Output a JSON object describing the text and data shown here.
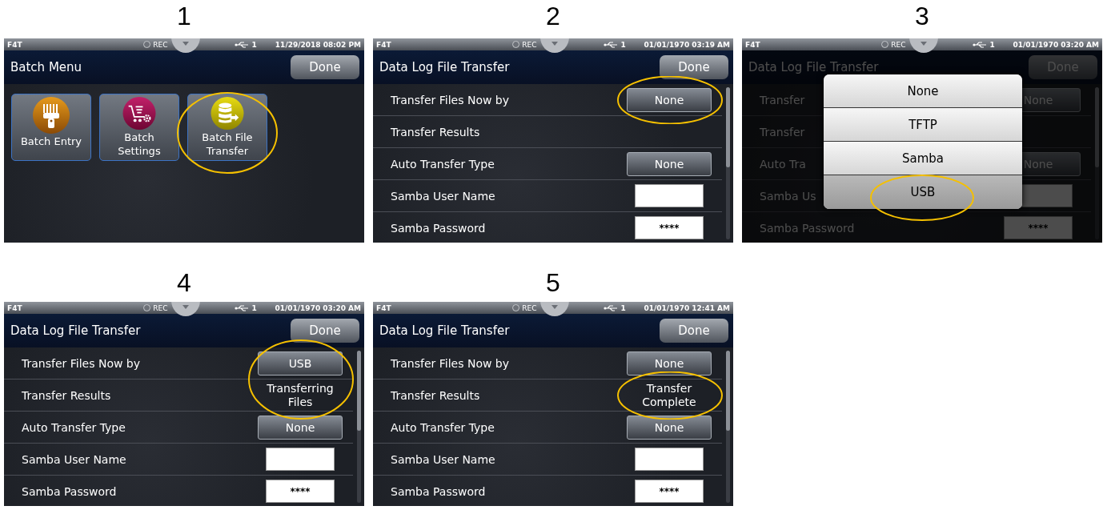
{
  "screens": [
    {
      "step": "1",
      "status_bar": {
        "device": "F4T",
        "rec": "REC",
        "usb": "1",
        "datetime": "11/29/2018 08:02 PM"
      },
      "title": "Batch Menu",
      "done": "Done",
      "dimmed": false,
      "tiles": [
        {
          "label": "Batch Entry",
          "kind": "scanner",
          "circled": false
        },
        {
          "label": "Batch Settings",
          "kind": "cart",
          "circled": false
        },
        {
          "label": "Batch File Transfer",
          "kind": "database",
          "circled": true
        }
      ]
    },
    {
      "step": "2",
      "status_bar": {
        "device": "F4T",
        "rec": "REC",
        "usb": "1",
        "datetime": "01/01/1970 03:19 AM"
      },
      "title": "Data Log File Transfer",
      "done": "Done",
      "dimmed": false,
      "rows": [
        {
          "label": "Transfer Files Now by",
          "kind": "button",
          "value": "None",
          "circled": true
        },
        {
          "label": "Transfer Results",
          "kind": "empty",
          "circled": false
        },
        {
          "label": "Auto Transfer Type",
          "kind": "button",
          "value": "None",
          "circled": false
        },
        {
          "label": "Samba User Name",
          "kind": "field",
          "circled": false
        },
        {
          "label": "Samba Password",
          "kind": "field",
          "value": "****",
          "circled": false
        }
      ]
    },
    {
      "step": "3",
      "status_bar": {
        "device": "F4T",
        "rec": "REC",
        "usb": "1",
        "datetime": "01/01/1970 03:20 AM"
      },
      "title": "Data Log File Transfer",
      "done": "Done",
      "dimmed": true,
      "rows": [
        {
          "label": "Transfer",
          "kind": "button",
          "value": "None",
          "circled": false
        },
        {
          "label": "Transfer",
          "kind": "empty",
          "circled": false
        },
        {
          "label": "Auto Tra",
          "kind": "button",
          "value": "None",
          "circled": false
        },
        {
          "label": "Samba Us",
          "kind": "field",
          "circled": false
        },
        {
          "label": "Samba Password",
          "kind": "field",
          "value": "****",
          "circled": false
        }
      ],
      "menu": [
        {
          "label": "None",
          "selected": false,
          "circled": false
        },
        {
          "label": "TFTP",
          "selected": false,
          "circled": false
        },
        {
          "label": "Samba",
          "selected": false,
          "circled": false
        },
        {
          "label": "USB",
          "selected": true,
          "circled": true
        }
      ]
    },
    {
      "step": "4",
      "status_bar": {
        "device": "F4T",
        "rec": "REC",
        "usb": "1",
        "datetime": "01/01/1970 03:20 AM"
      },
      "title": "Data Log File Transfer",
      "done": "Done",
      "dimmed": false,
      "rows": [
        {
          "label": "Transfer Files Now by",
          "kind": "button",
          "value": "USB",
          "circled": true
        },
        {
          "label": "Transfer Results",
          "kind": "text",
          "value": "Transferring Files",
          "circled": true
        },
        {
          "label": "Auto Transfer Type",
          "kind": "button",
          "value": "None",
          "circled": false
        },
        {
          "label": "Samba User Name",
          "kind": "field",
          "circled": false
        },
        {
          "label": "Samba Password",
          "kind": "field",
          "value": "****",
          "circled": false
        }
      ]
    },
    {
      "step": "5",
      "status_bar": {
        "device": "F4T",
        "rec": "REC",
        "usb": "1",
        "datetime": "01/01/1970 12:41 AM"
      },
      "title": "Data Log File Transfer",
      "done": "Done",
      "dimmed": false,
      "rows": [
        {
          "label": "Transfer Files Now by",
          "kind": "button",
          "value": "None",
          "circled": false
        },
        {
          "label": "Transfer Results",
          "kind": "text",
          "value": "Transfer Complete",
          "circled": true
        },
        {
          "label": "Auto Transfer Type",
          "kind": "button",
          "value": "None",
          "circled": false
        },
        {
          "label": "Samba User Name",
          "kind": "field",
          "circled": false
        },
        {
          "label": "Samba Password",
          "kind": "field",
          "value": "****",
          "circled": false
        }
      ]
    }
  ]
}
